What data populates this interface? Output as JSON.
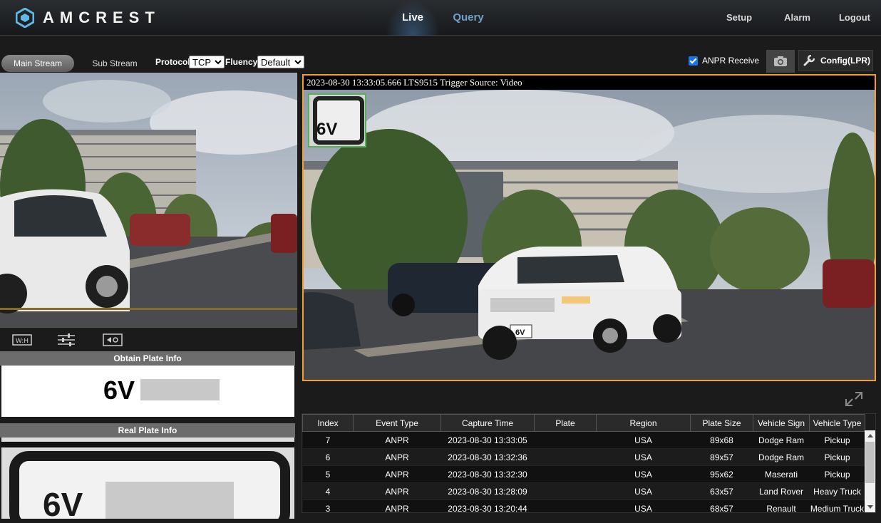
{
  "header": {
    "brand": "AMCREST",
    "tabs": [
      {
        "label": "Live",
        "active": true
      },
      {
        "label": "Query",
        "active": false
      }
    ],
    "links": [
      "Setup",
      "Alarm",
      "Logout"
    ]
  },
  "toolbar": {
    "main_stream": "Main Stream",
    "sub_stream": "Sub Stream",
    "protocol_label": "Protocol",
    "protocol_value": "TCP",
    "fluency_label": "Fluency",
    "fluency_value": "Default",
    "anpr_receive": "ANPR Receive",
    "anpr_checked": true,
    "config_label": "Config(LPR)"
  },
  "left_panel": {
    "obtain_title": "Obtain Plate Info",
    "plate_prefix": "6V",
    "real_title": "Real Plate Info",
    "real_plate_prefix": "6V",
    "control_icons": [
      "wh-icon",
      "sliders-icon",
      "ptz-icon"
    ]
  },
  "main_view": {
    "osd": "2023-08-30 13:33:05.666 LTS9515 Trigger Source: Video",
    "inset_plate": "6V",
    "car_plate": "6V"
  },
  "events": {
    "columns": [
      "Index",
      "Event Type",
      "Capture Time",
      "Plate",
      "Region",
      "Plate Size",
      "Vehicle Sign",
      "Vehicle Type"
    ],
    "rows": [
      {
        "index": "7",
        "event_type": "ANPR",
        "capture_time": "2023-08-30 13:33:05",
        "plate": "",
        "region": "USA",
        "plate_size": "89x68",
        "vehicle_sign": "Dodge Ram",
        "vehicle_type": "Pickup"
      },
      {
        "index": "6",
        "event_type": "ANPR",
        "capture_time": "2023-08-30 13:32:36",
        "plate": "",
        "region": "USA",
        "plate_size": "89x57",
        "vehicle_sign": "Dodge Ram",
        "vehicle_type": "Pickup"
      },
      {
        "index": "5",
        "event_type": "ANPR",
        "capture_time": "2023-08-30 13:32:30",
        "plate": "",
        "region": "USA",
        "plate_size": "95x62",
        "vehicle_sign": "Maserati",
        "vehicle_type": "Pickup"
      },
      {
        "index": "4",
        "event_type": "ANPR",
        "capture_time": "2023-08-30 13:28:09",
        "plate": "",
        "region": "USA",
        "plate_size": "63x57",
        "vehicle_sign": "Land Rover",
        "vehicle_type": "Heavy Truck"
      },
      {
        "index": "3",
        "event_type": "ANPR",
        "capture_time": "2023-08-30 13:20:44",
        "plate": "",
        "region": "USA",
        "plate_size": "68x57",
        "vehicle_sign": "Renault",
        "vehicle_type": "Medium Truck"
      }
    ]
  },
  "colors": {
    "accent_orange": "#f0a030",
    "checkbox_blue": "#1a73e8",
    "inactive_tab": "#6fa0c8"
  }
}
